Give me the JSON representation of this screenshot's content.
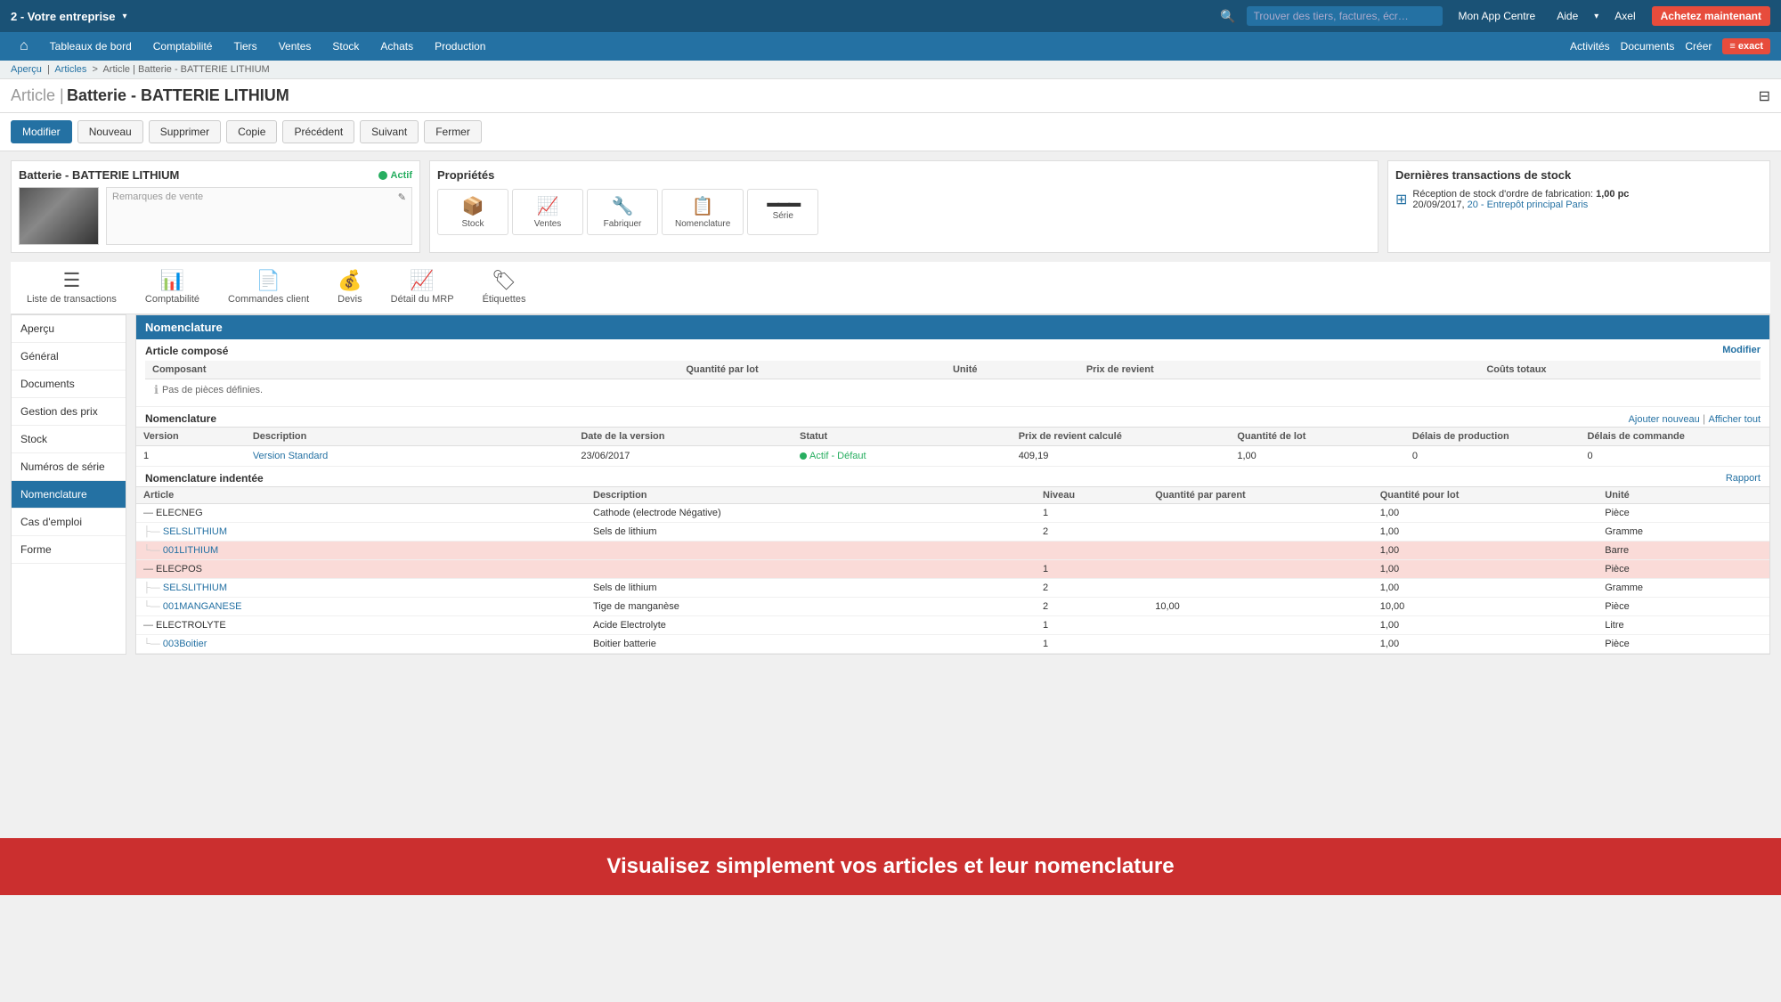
{
  "app": {
    "company": "2 - Votre entreprise",
    "title": "Article | Batterie - BATTERIE LITHIUM"
  },
  "topbar": {
    "search_placeholder": "Trouver des tiers, factures, écr…",
    "app_center": "Mon App Centre",
    "help": "Aide",
    "user": "Axel",
    "buy_btn": "Achetez maintenant"
  },
  "navbar": {
    "home_icon": "⌂",
    "items": [
      "Tableaux de bord",
      "Comptabilité",
      "Tiers",
      "Ventes",
      "Stock",
      "Achats",
      "Production"
    ],
    "right_items": [
      "Activités",
      "Documents",
      "Créer"
    ],
    "exact_logo": "≡ exact"
  },
  "breadcrumb": {
    "parts": [
      "Aperçu",
      "Articles",
      "Article | Batterie - BATTERIE LITHIUM"
    ]
  },
  "page": {
    "title": "Article",
    "subtitle": "Batterie - BATTERIE LITHIUM",
    "filter_icon": "⊟"
  },
  "action_buttons": [
    "Modifier",
    "Nouveau",
    "Supprimer",
    "Copie",
    "Précédent",
    "Suivant",
    "Fermer"
  ],
  "article_panel": {
    "title": "Batterie - BATTERIE LITHIUM",
    "active_label": "Actif",
    "remarks_label": "Remarques de vente",
    "edit_icon": "✎"
  },
  "properties_panel": {
    "title": "Propriétés",
    "items": [
      {
        "icon": "📦",
        "label": "Stock"
      },
      {
        "icon": "📈",
        "label": "Ventes"
      },
      {
        "icon": "🔧",
        "label": "Fabriquer"
      },
      {
        "icon": "📋",
        "label": "Nomenclature"
      },
      {
        "icon": "▬▬▬",
        "label": "Série"
      }
    ]
  },
  "transactions_panel": {
    "title": "Dernières transactions de stock",
    "items": [
      {
        "text": "Réception de stock d'ordre de fabrication:",
        "value": "1,00 pc",
        "date": "20/09/2017,",
        "link_text": "20 - Entrepôt principal Paris"
      }
    ]
  },
  "tabs": [
    {
      "icon": "☰",
      "label": "Liste de transactions"
    },
    {
      "icon": "📊",
      "label": "Comptabilité"
    },
    {
      "icon": "📄",
      "label": "Commandes client"
    },
    {
      "icon": "💰",
      "label": "Devis"
    },
    {
      "icon": "📈",
      "label": "Détail du MRP"
    },
    {
      "icon": "🏷",
      "label": "Étiquettes"
    }
  ],
  "sidebar": {
    "items": [
      {
        "label": "Aperçu",
        "active": false
      },
      {
        "label": "Général",
        "active": false
      },
      {
        "label": "Documents",
        "active": false
      },
      {
        "label": "Gestion des prix",
        "active": false
      },
      {
        "label": "Stock",
        "active": false
      },
      {
        "label": "Numéros de série",
        "active": false
      },
      {
        "label": "Nomenclature",
        "active": true
      },
      {
        "label": "Cas d'emploi",
        "active": false
      },
      {
        "label": "Forme",
        "active": false
      }
    ]
  },
  "nomenclature": {
    "section_title": "Nomenclature",
    "article_compose_title": "Article composé",
    "modifier_link": "Modifier",
    "composant_columns": [
      "Composant",
      "Quantité par lot",
      "Unité",
      "Prix de revient",
      "Coûts totaux"
    ],
    "no_pieces_msg": "Pas de pièces définies.",
    "nomenclature_title": "Nomenclature",
    "ajouter_link": "Ajouter nouveau",
    "afficher_link": "Afficher tout",
    "nom_columns": [
      "Version",
      "Description",
      "Date de la version",
      "Statut",
      "Prix de revient calculé",
      "Quantité de lot",
      "Délais de production",
      "Délais de commande"
    ],
    "nom_row": {
      "version": "1",
      "description": "Version Standard",
      "date": "23/06/2017",
      "statut": "Actif - Défaut",
      "prix": "409,19",
      "quantite": "1,00",
      "delais_prod": "0",
      "delais_cmd": "0"
    },
    "indented_title": "Nomenclature indentée",
    "rapport_link": "Rapport",
    "indent_columns": [
      "Article",
      "Description",
      "Niveau",
      "Quantité par parent",
      "Quantité pour lot",
      "Unité"
    ],
    "indent_rows": [
      {
        "indent": 0,
        "article": "ELECNEG",
        "description": "Cathode (electrode Négative)",
        "niveau": "1",
        "qty_parent": "",
        "qty_lot": "1,00",
        "unite": "Pièce",
        "is_link": false,
        "highlighted": false
      },
      {
        "indent": 1,
        "article": "SELSLITHIUM",
        "description": "Sels de lithium",
        "niveau": "2",
        "qty_parent": "",
        "qty_lot": "1,00",
        "unite": "Gramme",
        "is_link": true,
        "highlighted": false
      },
      {
        "indent": 2,
        "article": "001LITHIUM",
        "description": "",
        "niveau": "",
        "qty_parent": "",
        "qty_lot": "1,00",
        "unite": "Barre",
        "is_link": true,
        "highlighted": true
      },
      {
        "indent": 0,
        "article": "ELECPOS",
        "description": "",
        "niveau": "1",
        "qty_parent": "",
        "qty_lot": "1,00",
        "unite": "Pièce",
        "is_link": false,
        "highlighted": false
      },
      {
        "indent": 1,
        "article": "SELSLITHIUM",
        "description": "Sels de lithium",
        "niveau": "2",
        "qty_parent": "",
        "qty_lot": "1,00",
        "unite": "Gramme",
        "is_link": true,
        "highlighted": false
      },
      {
        "indent": 1,
        "article": "001MANGANESE",
        "description": "Tige de manganèse",
        "niveau": "2",
        "qty_parent": "10,00",
        "qty_lot": "10,00",
        "unite": "Pièce",
        "is_link": true,
        "highlighted": false
      },
      {
        "indent": 0,
        "article": "ELECTROLYTE",
        "description": "Acide Electrolyte",
        "niveau": "1",
        "qty_parent": "",
        "qty_lot": "1,00",
        "unite": "Litre",
        "is_link": false,
        "highlighted": false
      },
      {
        "indent": 1,
        "article": "003Boitier",
        "description": "Boitier batterie",
        "niveau": "1",
        "qty_parent": "",
        "qty_lot": "1,00",
        "unite": "Pièce",
        "is_link": true,
        "highlighted": false
      }
    ]
  },
  "promo_banner": {
    "text": "Visualisez simplement vos articles et leur nomenclature"
  },
  "colors": {
    "primary": "#2471a3",
    "topbar_bg": "#1a5276",
    "active_green": "#27ae60",
    "danger": "#e74c3c",
    "highlight_row": "#fadbd8"
  }
}
